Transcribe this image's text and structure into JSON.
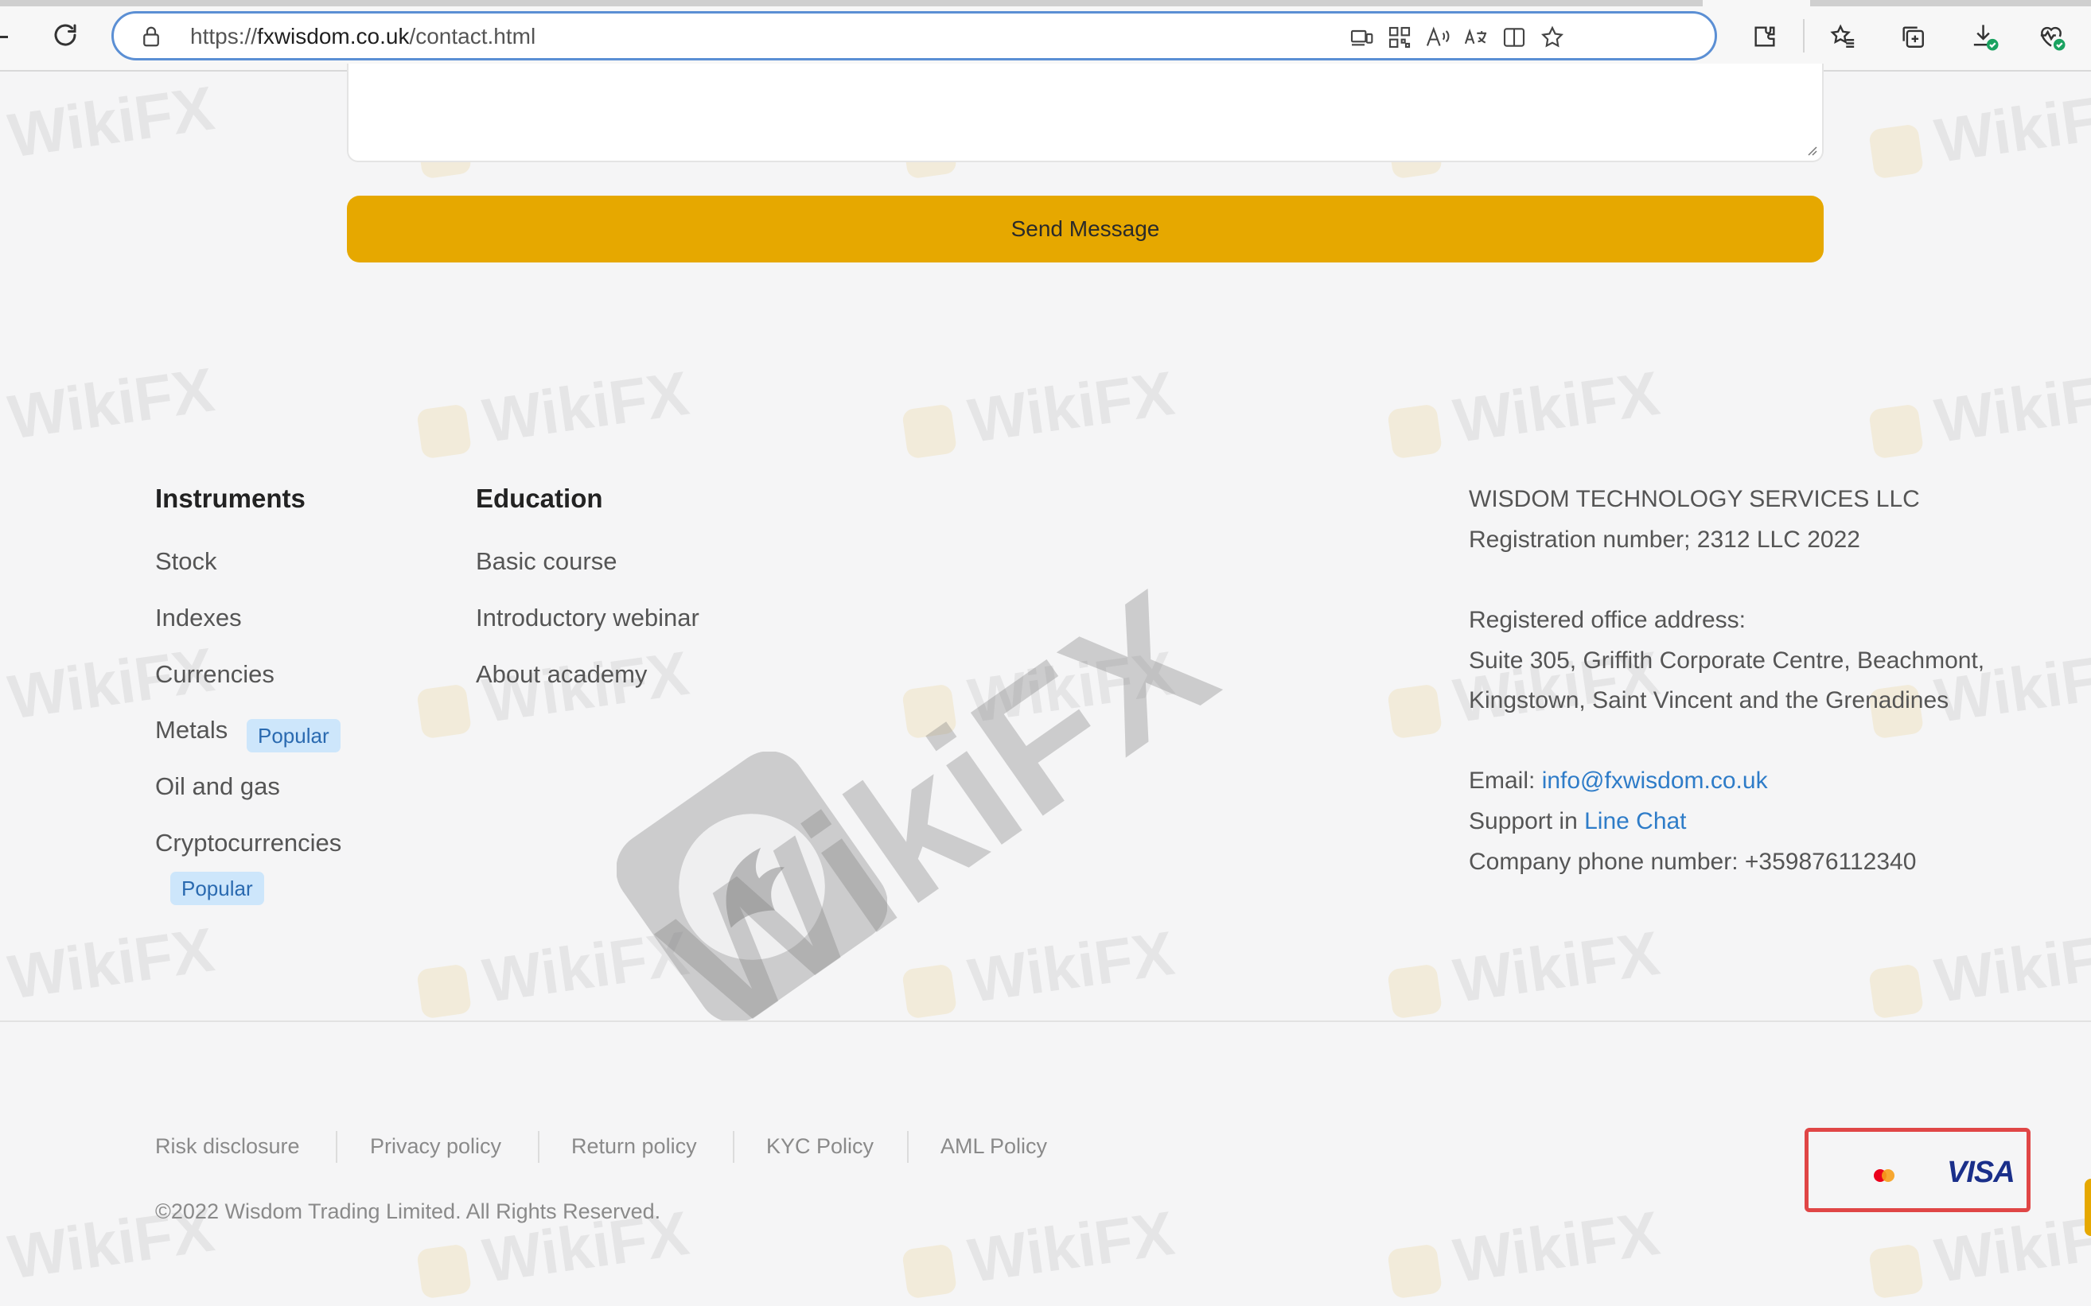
{
  "browser": {
    "url_scheme": "https://",
    "url_host": "fxwisdom.co.uk",
    "url_path": "/contact.html"
  },
  "form": {
    "send_label": "Send Message"
  },
  "footer": {
    "instruments": {
      "heading": "Instruments",
      "items": [
        "Stock",
        "Indexes",
        "Currencies",
        "Metals",
        "Oil and gas",
        "Cryptocurrencies"
      ],
      "popular_badge": "Popular"
    },
    "education": {
      "heading": "Education",
      "items": [
        "Basic course",
        "Introductory webinar",
        "About academy"
      ]
    },
    "company": {
      "name": "WISDOM TECHNOLOGY SERVICES LLC",
      "registration": "Registration number; 2312 LLC 2022",
      "office_label": "Registered office address:",
      "address_line1": "Suite 305, Griffith Corporate Centre, Beachmont,",
      "address_line2": "Kingstown, Saint Vincent and the Grenadines",
      "email_label": "Email: ",
      "email": "info@fxwisdom.co.uk",
      "support_label": "Support in ",
      "support_link": "Line Chat",
      "phone": "Company phone number: +359876112340"
    },
    "policies": [
      "Risk disclosure",
      "Privacy policy",
      "Return policy",
      "KYC Policy",
      "AML Policy"
    ],
    "copyright": "©2022 Wisdom Trading Limited. All Rights Reserved.",
    "payments": {
      "visa_label": "VISA",
      "icons": [
        "mastercard-icon",
        "visa-icon"
      ]
    }
  },
  "watermark": {
    "text": "WikiFX"
  },
  "colors": {
    "accent_button": "#e6a800",
    "link": "#2e7cc8",
    "badge_bg": "#cde6fb",
    "highlight_box": "#e04646"
  }
}
